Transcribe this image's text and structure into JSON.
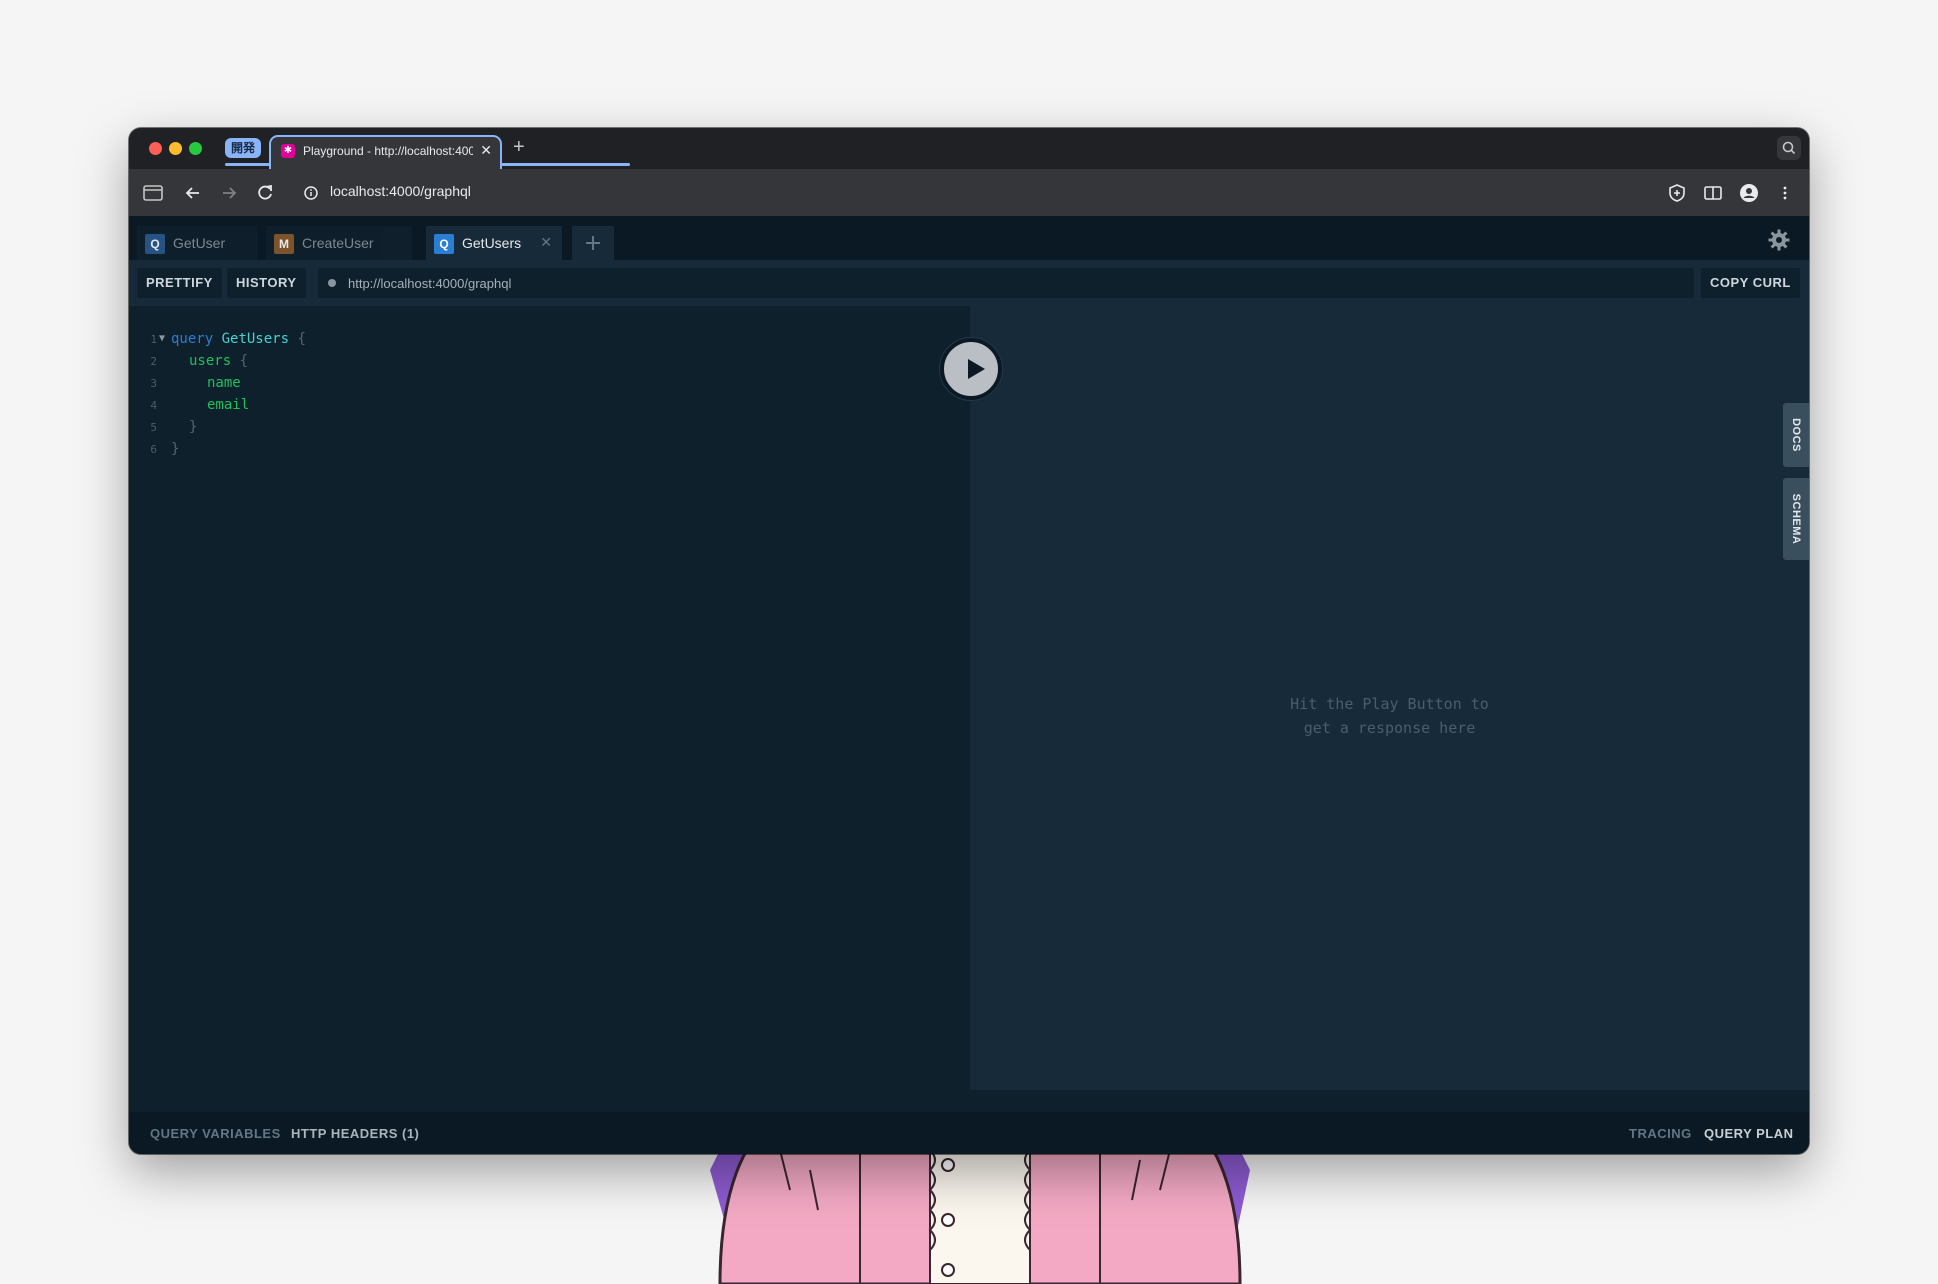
{
  "browser": {
    "tab_group_label": "開発",
    "tab_title": "Playground - http://localhost:4000/graphql",
    "address": "localhost:4000/graphql"
  },
  "playground": {
    "tabs": [
      {
        "type": "Q",
        "label": "GetUser",
        "color": "#2a6fc0"
      },
      {
        "type": "M",
        "label": "CreateUser",
        "color": "#b26a2e"
      },
      {
        "type": "Q",
        "label": "GetUsers",
        "color": "#2a7ed3"
      }
    ],
    "topbar": {
      "prettify": "PRETTIFY",
      "history": "HISTORY",
      "endpoint": "http://localhost:4000/graphql",
      "copy_curl": "COPY CURL"
    },
    "editor": {
      "line_numbers": [
        "1",
        "2",
        "3",
        "4",
        "5",
        "6"
      ],
      "keyword": "query",
      "operation_name": "GetUsers",
      "brace_open": "{",
      "brace_close": "}",
      "root_field": "users",
      "fields": [
        "name",
        "email"
      ]
    },
    "result_placeholder": [
      "Hit the Play Button to",
      "get a response here"
    ],
    "side_tabs": {
      "docs": "DOCS",
      "schema": "SCHEMA"
    },
    "bottom": {
      "query_variables": "QUERY VARIABLES",
      "http_headers": "HTTP HEADERS (1)",
      "tracing": "TRACING",
      "query_plan": "QUERY PLAN"
    }
  }
}
